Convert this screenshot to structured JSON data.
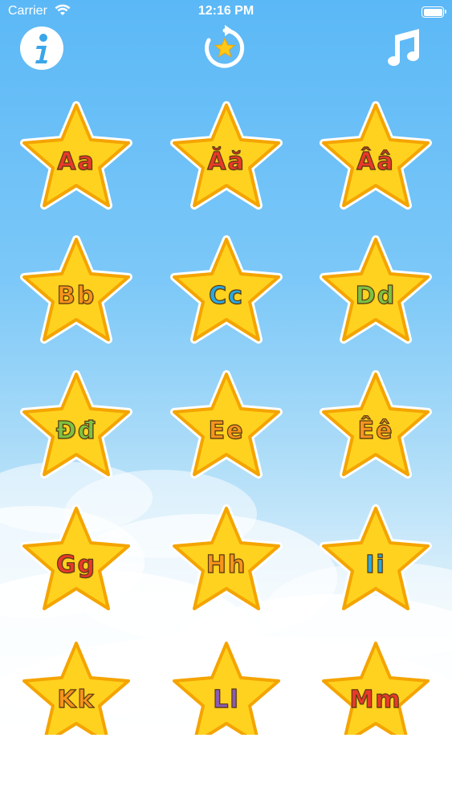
{
  "status_bar": {
    "carrier": "Carrier",
    "time": "12:16 PM",
    "battery_level": 1.0
  },
  "toolbar": {
    "info_icon": "info-icon",
    "reset_icon": "restart-star-icon",
    "music_icon": "music-note-icon"
  },
  "colors": {
    "star_fill": "#ffd21f",
    "star_border": "#f4a400",
    "red": "#e8392a",
    "orange": "#f7941d",
    "blue": "#2aa7e0",
    "green": "#7cc242",
    "purple": "#8a5bb7"
  },
  "letters": [
    {
      "label": "Aa",
      "color": "#e8392a"
    },
    {
      "label": "Ăă",
      "color": "#e8392a"
    },
    {
      "label": "Ââ",
      "color": "#e8392a"
    },
    {
      "label": "Bb",
      "color": "#f7941d"
    },
    {
      "label": "Cc",
      "color": "#2aa7e0"
    },
    {
      "label": "Dd",
      "color": "#7cc242"
    },
    {
      "label": "Đđ",
      "color": "#7cc242"
    },
    {
      "label": "Ee",
      "color": "#f7941d"
    },
    {
      "label": "Êê",
      "color": "#f7941d"
    },
    {
      "label": "Gg",
      "color": "#e8392a"
    },
    {
      "label": "Hh",
      "color": "#f7941d"
    },
    {
      "label": "Ii",
      "color": "#2aa7e0"
    },
    {
      "label": "Kk",
      "color": "#f7941d"
    },
    {
      "label": "Ll",
      "color": "#8a5bb7"
    },
    {
      "label": "Mm",
      "color": "#e8392a"
    }
  ]
}
